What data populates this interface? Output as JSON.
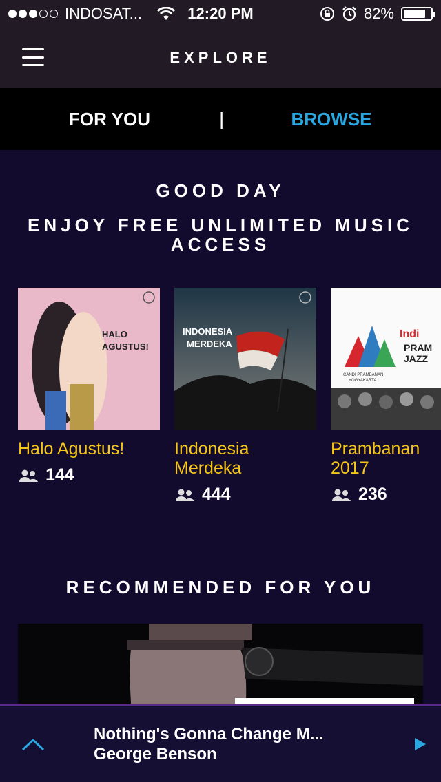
{
  "status": {
    "carrier": "INDOSAT...",
    "time": "12:20 PM",
    "battery": "82%",
    "battery_level": 0.82
  },
  "nav": {
    "title": "EXPLORE",
    "menu_icon": "hamburger-menu-icon"
  },
  "tabs": [
    {
      "label": "FOR YOU",
      "active": false
    },
    {
      "label": "BROWSE",
      "active": true
    }
  ],
  "tab_separator": "|",
  "greeting": "GOOD DAY",
  "subheading": "ENJOY FREE UNLIMITED MUSIC ACCESS",
  "playlists": [
    {
      "title": "Halo Agustus!",
      "title_lines": [
        "Halo Agustus!"
      ],
      "followers": "144",
      "art_text": [
        "HALO",
        "AGUSTUS!"
      ]
    },
    {
      "title": "Indonesia Merdeka",
      "title_lines": [
        "Indonesia",
        "Merdeka"
      ],
      "followers": "444",
      "art_text": [
        "INDONESIA",
        "MERDEKA"
      ]
    },
    {
      "title": "Prambanan 2017",
      "title_lines": [
        "Prambanan",
        "2017"
      ],
      "followers": "236",
      "art_text": [
        "Indi",
        "PRAM",
        "JAZZ",
        "CANDI PRAMBANAN",
        "YOGYAKARTA"
      ]
    }
  ],
  "recommended_title": "RECOMMENDED FOR YOU",
  "player": {
    "song": "Nothing's Gonna Change M...",
    "artist": "George Benson"
  },
  "colors": {
    "accent": "#2aa6e0",
    "highlight": "#f5c518",
    "background": "#120b2e"
  }
}
